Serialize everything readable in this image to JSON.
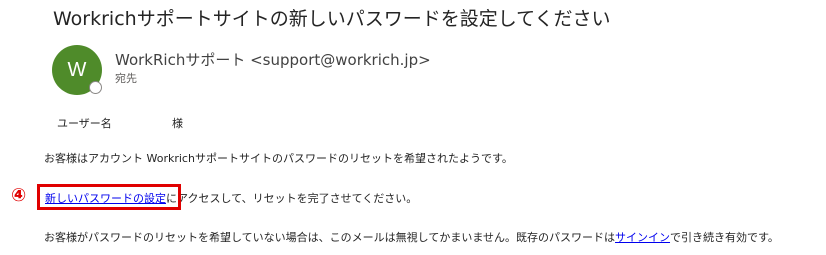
{
  "email": {
    "subject": "Workrichサポートサイトの新しいパスワードを設定してください",
    "sender": {
      "avatar_initial": "W",
      "display": "WorkRichサポート <support@workrich.jp>",
      "to_label": "宛先"
    },
    "body": {
      "greeting_name": "ユーザー名",
      "greeting_honorific": "様",
      "paragraph1": "お客様はアカウント Workrichサポートサイトのパスワードのリセットを希望されたようです。",
      "paragraph2_link": "新しいパスワードの設定",
      "paragraph2_rest": "にアクセスして、リセットを完了させてください。",
      "paragraph3_before": "お客様がパスワードのリセットを希望していない場合は、このメールは無視してかまいません。既存のパスワードは",
      "paragraph3_link": "サインイン",
      "paragraph3_after": "で引き続き有効です。"
    }
  },
  "annotation": {
    "step_marker": "④",
    "color": "#e00000"
  },
  "colors": {
    "avatar_bg": "#4f8b2a",
    "link": "#0000ee"
  }
}
